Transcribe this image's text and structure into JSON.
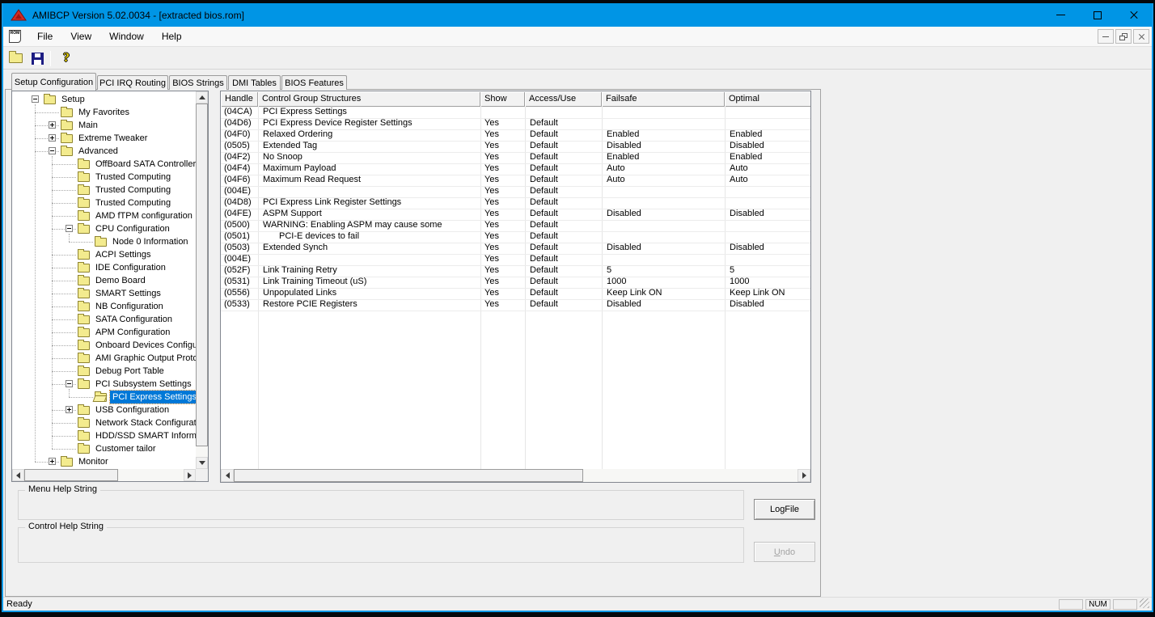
{
  "window": {
    "title": "AMIBCP Version 5.02.0034 - [extracted bios.rom]",
    "app_icon": "ami-red-logo",
    "controls": [
      "minimize",
      "maximize",
      "close"
    ]
  },
  "menu": {
    "items": [
      "File",
      "View",
      "Window",
      "Help"
    ],
    "doc_icon": "rom-document-icon"
  },
  "toolbar": {
    "icons": [
      "open-folder-icon",
      "save-floppy-icon",
      "help-question-icon"
    ]
  },
  "tabs": [
    {
      "label": "Setup Configuration",
      "active": true
    },
    {
      "label": "PCI IRQ Routing",
      "active": false
    },
    {
      "label": "BIOS Strings",
      "active": false
    },
    {
      "label": "DMI Tables",
      "active": false
    },
    {
      "label": "BIOS Features",
      "active": false
    }
  ],
  "tree": {
    "items": [
      {
        "level": 0,
        "label": "Setup",
        "expand": "minus",
        "selected": false
      },
      {
        "level": 1,
        "label": "My Favorites",
        "expand": "none",
        "selected": false
      },
      {
        "level": 1,
        "label": "Main",
        "expand": "plus",
        "selected": false
      },
      {
        "level": 1,
        "label": "Extreme Tweaker",
        "expand": "plus",
        "selected": false
      },
      {
        "level": 1,
        "label": "Advanced",
        "expand": "minus",
        "selected": false
      },
      {
        "level": 2,
        "label": "OffBoard SATA Controller (",
        "expand": "none",
        "selected": false
      },
      {
        "level": 2,
        "label": "Trusted Computing",
        "expand": "none",
        "selected": false
      },
      {
        "level": 2,
        "label": "Trusted Computing",
        "expand": "none",
        "selected": false
      },
      {
        "level": 2,
        "label": "Trusted Computing",
        "expand": "none",
        "selected": false
      },
      {
        "level": 2,
        "label": "AMD fTPM configuration",
        "expand": "none",
        "selected": false
      },
      {
        "level": 2,
        "label": "CPU Configuration",
        "expand": "minus",
        "selected": false
      },
      {
        "level": 3,
        "label": "Node 0 Information",
        "expand": "none",
        "selected": false
      },
      {
        "level": 2,
        "label": "ACPI Settings",
        "expand": "none",
        "selected": false
      },
      {
        "level": 2,
        "label": "IDE Configuration",
        "expand": "none",
        "selected": false
      },
      {
        "level": 2,
        "label": "Demo Board",
        "expand": "none",
        "selected": false
      },
      {
        "level": 2,
        "label": "SMART Settings",
        "expand": "none",
        "selected": false
      },
      {
        "level": 2,
        "label": "NB Configuration",
        "expand": "none",
        "selected": false
      },
      {
        "level": 2,
        "label": "SATA Configuration",
        "expand": "none",
        "selected": false
      },
      {
        "level": 2,
        "label": "APM Configuration",
        "expand": "none",
        "selected": false
      },
      {
        "level": 2,
        "label": "Onboard Devices Configur",
        "expand": "none",
        "selected": false
      },
      {
        "level": 2,
        "label": "AMI Graphic Output Protoc",
        "expand": "none",
        "selected": false
      },
      {
        "level": 2,
        "label": "Debug Port Table",
        "expand": "none",
        "selected": false
      },
      {
        "level": 2,
        "label": "PCI Subsystem Settings",
        "expand": "minus",
        "selected": false
      },
      {
        "level": 3,
        "label": "PCI Express Settings",
        "expand": "none",
        "selected": true,
        "open": true
      },
      {
        "level": 2,
        "label": "USB Configuration",
        "expand": "plus",
        "selected": false
      },
      {
        "level": 2,
        "label": "Network Stack Configurati",
        "expand": "none",
        "selected": false
      },
      {
        "level": 2,
        "label": "HDD/SSD SMART Informa",
        "expand": "none",
        "selected": false
      },
      {
        "level": 2,
        "label": "Customer tailor",
        "expand": "none",
        "selected": false
      },
      {
        "level": 1,
        "label": "Monitor",
        "expand": "plus",
        "selected": false
      }
    ]
  },
  "table": {
    "columns": [
      {
        "label": "Handle"
      },
      {
        "label": "Control Group Structures"
      },
      {
        "label": "Show"
      },
      {
        "label": "Access/Use"
      },
      {
        "label": "Failsafe"
      },
      {
        "label": "Optimal"
      }
    ],
    "rows": [
      {
        "handle": "(04CA)",
        "name": "PCI Express Settings",
        "show": "",
        "access": "",
        "failsafe": "",
        "optimal": "",
        "indent": false
      },
      {
        "handle": "(04D6)",
        "name": "PCI Express Device Register Settings",
        "show": "Yes",
        "access": "Default",
        "failsafe": "",
        "optimal": "",
        "indent": false
      },
      {
        "handle": "(04F0)",
        "name": "Relaxed Ordering",
        "show": "Yes",
        "access": "Default",
        "failsafe": "Enabled",
        "optimal": "Enabled",
        "indent": false
      },
      {
        "handle": "(0505)",
        "name": "Extended Tag",
        "show": "Yes",
        "access": "Default",
        "failsafe": "Disabled",
        "optimal": "Disabled",
        "indent": false
      },
      {
        "handle": "(04F2)",
        "name": "No Snoop",
        "show": "Yes",
        "access": "Default",
        "failsafe": "Enabled",
        "optimal": "Enabled",
        "indent": false
      },
      {
        "handle": "(04F4)",
        "name": "Maximum Payload",
        "show": "Yes",
        "access": "Default",
        "failsafe": "Auto",
        "optimal": "Auto",
        "indent": false
      },
      {
        "handle": "(04F6)",
        "name": "Maximum Read Request",
        "show": "Yes",
        "access": "Default",
        "failsafe": "Auto",
        "optimal": "Auto",
        "indent": false
      },
      {
        "handle": "(004E)",
        "name": "",
        "show": "Yes",
        "access": "Default",
        "failsafe": "",
        "optimal": "",
        "indent": false
      },
      {
        "handle": "(04D8)",
        "name": "PCI Express Link Register Settings",
        "show": "Yes",
        "access": "Default",
        "failsafe": "",
        "optimal": "",
        "indent": false
      },
      {
        "handle": "(04FE)",
        "name": "ASPM Support",
        "show": "Yes",
        "access": "Default",
        "failsafe": "Disabled",
        "optimal": "Disabled",
        "indent": false
      },
      {
        "handle": "(0500)",
        "name": "WARNING: Enabling ASPM may cause some",
        "show": "Yes",
        "access": "Default",
        "failsafe": "",
        "optimal": "",
        "indent": false
      },
      {
        "handle": "(0501)",
        "name": "PCI-E devices to fail",
        "show": "Yes",
        "access": "Default",
        "failsafe": "",
        "optimal": "",
        "indent": true
      },
      {
        "handle": "(0503)",
        "name": "Extended Synch",
        "show": "Yes",
        "access": "Default",
        "failsafe": "Disabled",
        "optimal": "Disabled",
        "indent": false
      },
      {
        "handle": "(004E)",
        "name": "",
        "show": "Yes",
        "access": "Default",
        "failsafe": "",
        "optimal": "",
        "indent": false
      },
      {
        "handle": "(052F)",
        "name": "Link Training Retry",
        "show": "Yes",
        "access": "Default",
        "failsafe": "5",
        "optimal": "5",
        "indent": false
      },
      {
        "handle": "(0531)",
        "name": "Link Training Timeout (uS)",
        "show": "Yes",
        "access": "Default",
        "failsafe": "1000",
        "optimal": "1000",
        "indent": false
      },
      {
        "handle": "(0556)",
        "name": "Unpopulated Links",
        "show": "Yes",
        "access": "Default",
        "failsafe": "Keep Link ON",
        "optimal": "Keep Link ON",
        "indent": false
      },
      {
        "handle": "(0533)",
        "name": "Restore PCIE Registers",
        "show": "Yes",
        "access": "Default",
        "failsafe": "Disabled",
        "optimal": "Disabled",
        "indent": false
      }
    ]
  },
  "panels": {
    "menu_help_label": "Menu Help String",
    "control_help_label": "Control Help String"
  },
  "buttons": {
    "logfile": "LogFile",
    "undo_initial": "U",
    "undo_rest": "ndo"
  },
  "statusbar": {
    "ready": "Ready",
    "num": "NUM"
  },
  "colors": {
    "titlebar": "#0095e5",
    "frame_accent": "#0f9ae8",
    "selection": "#0078d7",
    "folder_fill": "#f3eb8e",
    "gridline": "#e6e6e6",
    "chrome": "#f0f0f0"
  }
}
